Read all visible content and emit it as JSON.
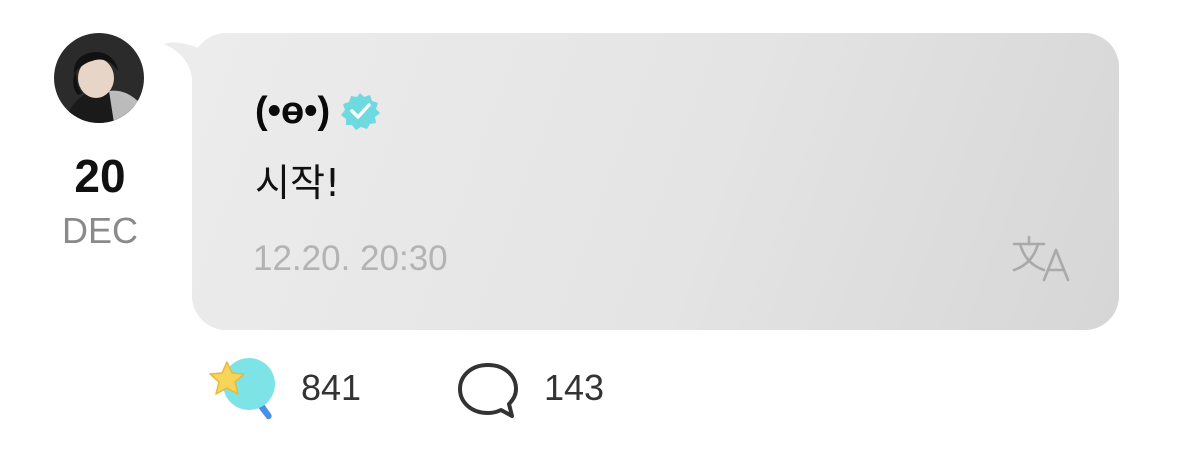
{
  "post": {
    "author": {
      "name": "(•ɵ•)",
      "verified_icon": "verified-badge-icon",
      "avatar_icon": "profile-photo"
    },
    "date": {
      "day": "20",
      "month": "DEC"
    },
    "message": "시작!",
    "timestamp": "12.20. 20:30",
    "translate_icon": "translate-icon"
  },
  "reactions": {
    "like_icon": "star-wand-icon",
    "like_count": "841",
    "comment_icon": "speech-bubble-icon",
    "comment_count": "143"
  },
  "colors": {
    "bubble_background": "#e6e6e6",
    "verified_badge": "#6fd9e0",
    "timestamp": "#b3b3b3",
    "month_label": "#8a8a8a"
  }
}
